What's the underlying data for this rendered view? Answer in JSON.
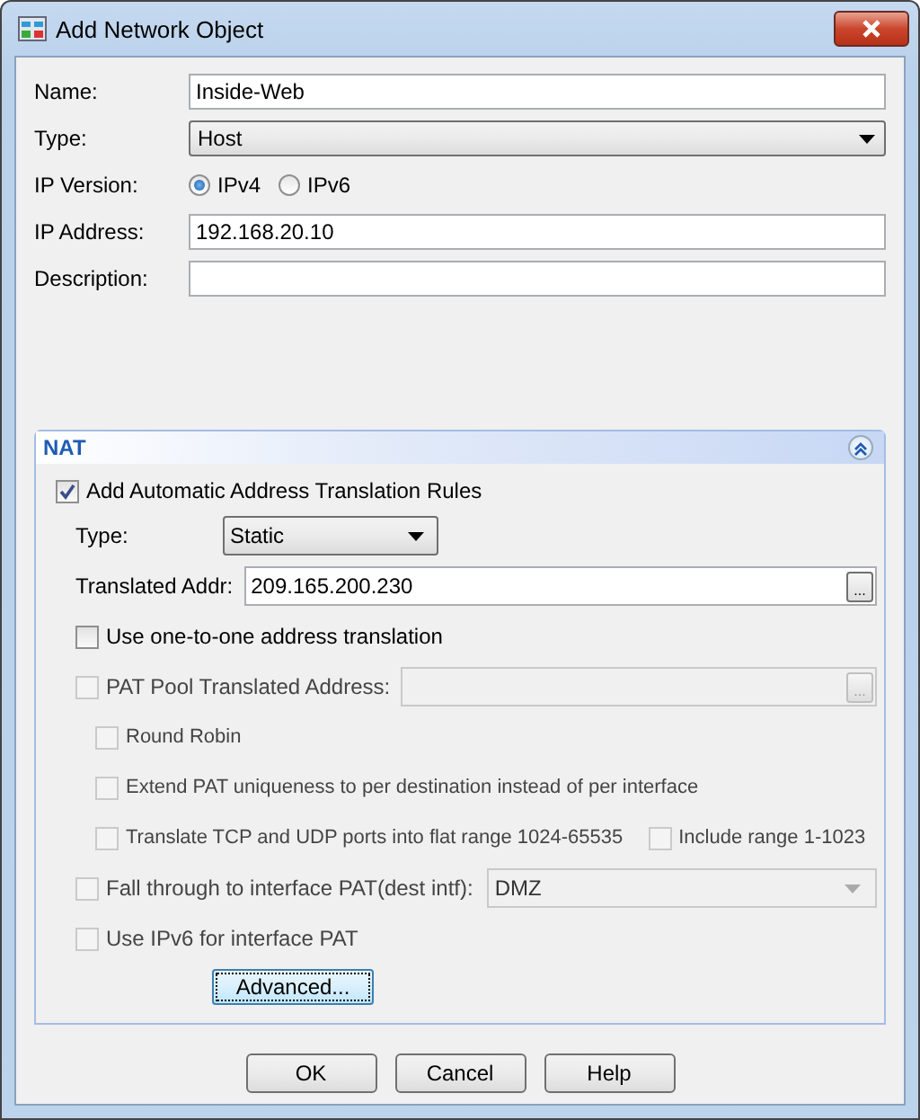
{
  "window": {
    "title": "Add Network Object"
  },
  "fields": [
    {
      "kind": "text",
      "label": "Name:",
      "value": "Inside-Web"
    },
    {
      "kind": "select",
      "label": "Type:",
      "value": "Host"
    },
    {
      "kind": "radio",
      "label": "IP Version:",
      "options": [
        {
          "label": "IPv4",
          "selected": true
        },
        {
          "label": "IPv6",
          "selected": false
        }
      ]
    },
    {
      "kind": "text",
      "label": "IP Address:",
      "value": "192.168.20.10"
    },
    {
      "kind": "text",
      "label": "Description:"
    }
  ],
  "nat": {
    "title": "NAT",
    "expanded": true,
    "auto_rules": {
      "label": "Add Automatic Address Translation Rules",
      "checked": true
    },
    "type": {
      "label": "Type:",
      "value": "Static"
    },
    "translated_addr": {
      "label": "Translated Addr:",
      "value": "209.165.200.230",
      "browse": "..."
    },
    "options": [
      {
        "kind": "check",
        "label": "Use one-to-one address translation",
        "checked": false,
        "disabled": false
      },
      {
        "kind": "check-field",
        "label": "PAT Pool Translated Address:",
        "checked": false,
        "disabled": true,
        "browse": "...",
        "children": [
          {
            "label": "Round Robin",
            "checked": false,
            "disabled": true
          },
          {
            "label": "Extend PAT uniqueness to per destination instead of per interface",
            "checked": false,
            "disabled": true
          },
          {
            "label": "Translate TCP and UDP ports into flat range 1024-65535",
            "checked": false,
            "disabled": true,
            "extra": {
              "label": "Include range 1-1023",
              "checked": false,
              "disabled": true
            }
          }
        ]
      },
      {
        "kind": "check-select",
        "label": "Fall through to interface PAT(dest intf):",
        "value": "DMZ",
        "checked": false,
        "disabled": true
      },
      {
        "kind": "check",
        "label": "Use IPv6 for interface PAT",
        "checked": false,
        "disabled": true
      }
    ],
    "advanced": {
      "label": "Advanced...",
      "focused": true
    }
  },
  "buttons": [
    "OK",
    "Cancel",
    "Help"
  ]
}
